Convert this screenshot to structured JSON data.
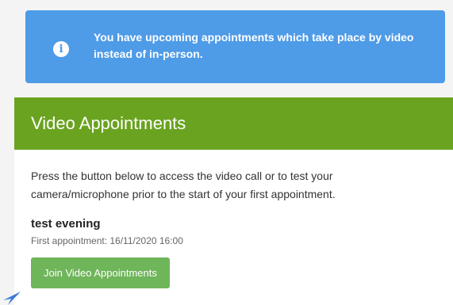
{
  "alert": {
    "icon": "info-icon",
    "message": "You have upcoming appointments which take place by video instead of in-person."
  },
  "card": {
    "title": "Video Appointments",
    "description": "Press the button below to access the video call or to test your camera/microphone prior to the start of your first appointment.",
    "appointment_name": "test evening",
    "first_appointment": "First appointment: 16/11/2020 16:00",
    "join_button_label": "Join Video Appointments"
  },
  "colors": {
    "alert_bg": "#4e9be8",
    "header_bg": "#6aa320",
    "button_bg": "#6fb55a"
  }
}
